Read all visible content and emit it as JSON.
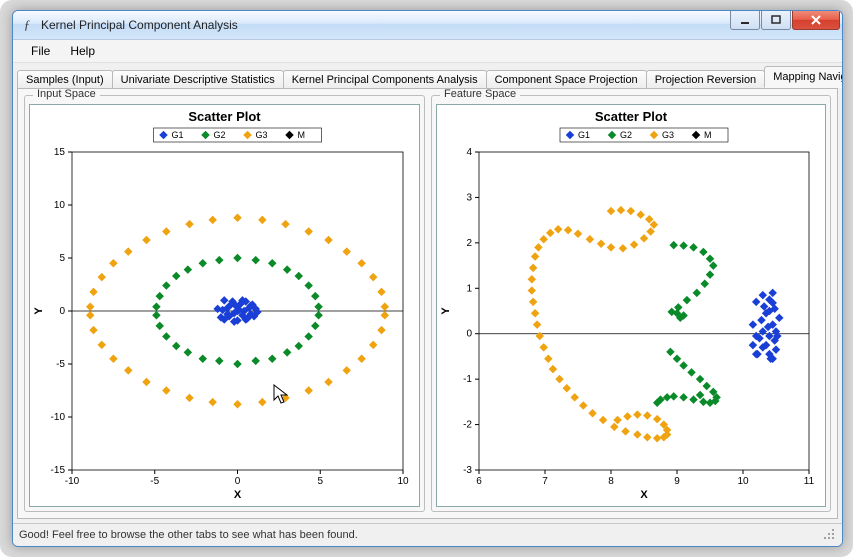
{
  "window": {
    "title": "Kernel Principal Component Analysis"
  },
  "menu": {
    "file": "File",
    "help": "Help"
  },
  "tabs": {
    "items": [
      {
        "label": "Samples (Input)"
      },
      {
        "label": "Univariate Descriptive Statistics"
      },
      {
        "label": "Kernel Principal Components Analysis"
      },
      {
        "label": "Component Space Projection"
      },
      {
        "label": "Projection Reversion"
      },
      {
        "label": "Mapping Navigation"
      }
    ],
    "active_index": 5
  },
  "panels": {
    "left_title": "Input Space",
    "right_title": "Feature Space"
  },
  "status": {
    "text": "Good! Feel free to browse the other tabs to see what has been found."
  },
  "chart_data": [
    {
      "type": "scatter",
      "title": "Scatter Plot",
      "xlabel": "X",
      "ylabel": "Y",
      "xlim": [
        -10,
        10
      ],
      "ylim": [
        -15,
        15
      ],
      "xticks": [
        -10,
        -5,
        0,
        5,
        10
      ],
      "yticks": [
        -15,
        -10,
        -5,
        0,
        5,
        10,
        15
      ],
      "legend": [
        "G1",
        "G2",
        "G3",
        "M"
      ],
      "colors": {
        "G1": "#1a3fd6",
        "G2": "#0a8a28",
        "G3": "#f0a310",
        "M": "#000000"
      },
      "series": [
        {
          "name": "G1",
          "points": [
            [
              -1.2,
              0.2
            ],
            [
              -1.0,
              -0.6
            ],
            [
              -0.8,
              1.0
            ],
            [
              -0.8,
              -0.8
            ],
            [
              -0.6,
              0.3
            ],
            [
              -0.5,
              -0.5
            ],
            [
              -0.3,
              0.9
            ],
            [
              -0.2,
              -0.2
            ],
            [
              -0.1,
              0.5
            ],
            [
              0.0,
              -0.9
            ],
            [
              0.1,
              0.1
            ],
            [
              0.2,
              0.7
            ],
            [
              0.3,
              -0.4
            ],
            [
              0.4,
              0.0
            ],
            [
              0.5,
              0.9
            ],
            [
              0.6,
              -0.7
            ],
            [
              0.7,
              0.3
            ],
            [
              0.8,
              -0.3
            ],
            [
              0.9,
              0.6
            ],
            [
              1.0,
              -0.5
            ],
            [
              1.1,
              0.2
            ],
            [
              1.2,
              -0.1
            ],
            [
              0.0,
              0.0
            ],
            [
              -0.4,
              0.6
            ],
            [
              0.5,
              -0.8
            ],
            [
              -0.9,
              0.1
            ],
            [
              0.3,
              1.0
            ],
            [
              -0.2,
              -1.0
            ],
            [
              0.8,
              0.5
            ],
            [
              -0.6,
              -0.3
            ]
          ]
        },
        {
          "name": "G2",
          "points": [
            [
              4.9,
              0.4
            ],
            [
              4.7,
              1.4
            ],
            [
              4.3,
              2.4
            ],
            [
              3.7,
              3.3
            ],
            [
              3.0,
              3.9
            ],
            [
              2.1,
              4.5
            ],
            [
              1.1,
              4.8
            ],
            [
              0.0,
              5.0
            ],
            [
              -1.1,
              4.8
            ],
            [
              -2.1,
              4.5
            ],
            [
              -3.0,
              3.9
            ],
            [
              -3.7,
              3.3
            ],
            [
              -4.3,
              2.4
            ],
            [
              -4.7,
              1.4
            ],
            [
              -4.9,
              0.4
            ],
            [
              -4.9,
              -0.4
            ],
            [
              -4.7,
              -1.4
            ],
            [
              -4.3,
              -2.4
            ],
            [
              -3.7,
              -3.3
            ],
            [
              -3.0,
              -3.9
            ],
            [
              -2.1,
              -4.5
            ],
            [
              -1.1,
              -4.7
            ],
            [
              0.0,
              -5.0
            ],
            [
              1.1,
              -4.7
            ],
            [
              2.1,
              -4.5
            ],
            [
              3.0,
              -3.9
            ],
            [
              3.7,
              -3.3
            ],
            [
              4.3,
              -2.4
            ],
            [
              4.7,
              -1.4
            ],
            [
              4.9,
              -0.4
            ]
          ]
        },
        {
          "name": "G3",
          "points": [
            [
              8.9,
              0.4
            ],
            [
              8.7,
              1.8
            ],
            [
              8.2,
              3.2
            ],
            [
              7.5,
              4.5
            ],
            [
              6.6,
              5.6
            ],
            [
              5.5,
              6.7
            ],
            [
              4.3,
              7.5
            ],
            [
              2.9,
              8.2
            ],
            [
              1.5,
              8.6
            ],
            [
              0.0,
              8.8
            ],
            [
              -1.5,
              8.6
            ],
            [
              -2.9,
              8.2
            ],
            [
              -4.3,
              7.5
            ],
            [
              -5.5,
              6.7
            ],
            [
              -6.6,
              5.6
            ],
            [
              -7.5,
              4.5
            ],
            [
              -8.2,
              3.2
            ],
            [
              -8.7,
              1.8
            ],
            [
              -8.9,
              0.4
            ],
            [
              -8.9,
              -0.4
            ],
            [
              -8.7,
              -1.8
            ],
            [
              -8.2,
              -3.2
            ],
            [
              -7.5,
              -4.5
            ],
            [
              -6.6,
              -5.6
            ],
            [
              -5.5,
              -6.7
            ],
            [
              -4.3,
              -7.5
            ],
            [
              -2.9,
              -8.2
            ],
            [
              -1.5,
              -8.6
            ],
            [
              0.0,
              -8.8
            ],
            [
              1.5,
              -8.6
            ],
            [
              2.9,
              -8.2
            ],
            [
              4.3,
              -7.5
            ],
            [
              5.5,
              -6.7
            ],
            [
              6.6,
              -5.6
            ],
            [
              7.5,
              -4.5
            ],
            [
              8.2,
              -3.2
            ],
            [
              8.7,
              -1.8
            ],
            [
              8.9,
              -0.4
            ]
          ]
        }
      ]
    },
    {
      "type": "scatter",
      "title": "Scatter Plot",
      "xlabel": "X",
      "ylabel": "Y",
      "xlim": [
        6,
        11
      ],
      "ylim": [
        -3,
        4
      ],
      "xticks": [
        6,
        7,
        8,
        9,
        10,
        11
      ],
      "yticks": [
        -3,
        -2,
        -1,
        0,
        1,
        2,
        3,
        4
      ],
      "legend": [
        "G1",
        "G2",
        "G3",
        "M"
      ],
      "colors": {
        "G1": "#1a3fd6",
        "G2": "#0a8a28",
        "G3": "#f0a310",
        "M": "#000000"
      },
      "series": [
        {
          "name": "G1",
          "points": [
            [
              10.45,
              0.9
            ],
            [
              10.45,
              0.68
            ],
            [
              10.4,
              0.5
            ],
            [
              10.55,
              0.35
            ],
            [
              10.45,
              0.2
            ],
            [
              10.5,
              0.05
            ],
            [
              10.4,
              -0.05
            ],
            [
              10.48,
              -0.15
            ],
            [
              10.35,
              -0.25
            ],
            [
              10.5,
              -0.35
            ],
            [
              10.4,
              -0.45
            ],
            [
              10.45,
              -0.55
            ],
            [
              10.3,
              0.85
            ],
            [
              10.32,
              0.6
            ],
            [
              10.28,
              0.3
            ],
            [
              10.3,
              0.05
            ],
            [
              10.25,
              -0.1
            ],
            [
              10.3,
              -0.3
            ],
            [
              10.22,
              -0.45
            ],
            [
              10.35,
              0.45
            ],
            [
              10.2,
              0.7
            ],
            [
              10.15,
              0.2
            ],
            [
              10.2,
              -0.05
            ],
            [
              10.15,
              -0.25
            ],
            [
              10.2,
              -0.45
            ],
            [
              10.4,
              0.75
            ],
            [
              10.48,
              0.55
            ],
            [
              10.38,
              0.15
            ],
            [
              10.52,
              -0.05
            ],
            [
              10.42,
              -0.55
            ]
          ]
        },
        {
          "name": "G2",
          "points": [
            [
              8.95,
              1.95
            ],
            [
              9.1,
              1.94
            ],
            [
              9.25,
              1.9
            ],
            [
              9.4,
              1.8
            ],
            [
              9.5,
              1.65
            ],
            [
              9.55,
              1.5
            ],
            [
              9.5,
              1.3
            ],
            [
              9.42,
              1.1
            ],
            [
              9.3,
              0.9
            ],
            [
              9.15,
              0.74
            ],
            [
              9.02,
              0.58
            ],
            [
              8.92,
              0.48
            ],
            [
              9.0,
              0.45
            ],
            [
              9.1,
              0.4
            ],
            [
              9.05,
              0.35
            ],
            [
              8.9,
              -0.4
            ],
            [
              9.0,
              -0.55
            ],
            [
              9.1,
              -0.7
            ],
            [
              9.22,
              -0.85
            ],
            [
              9.35,
              -1.0
            ],
            [
              9.45,
              -1.15
            ],
            [
              9.55,
              -1.28
            ],
            [
              9.6,
              -1.4
            ],
            [
              9.58,
              -1.48
            ],
            [
              9.5,
              -1.52
            ],
            [
              9.4,
              -1.5
            ],
            [
              9.25,
              -1.45
            ],
            [
              9.1,
              -1.4
            ],
            [
              8.95,
              -1.38
            ],
            [
              8.85,
              -1.4
            ],
            [
              8.75,
              -1.45
            ],
            [
              8.7,
              -1.52
            ],
            [
              9.35,
              -1.35
            ]
          ]
        },
        {
          "name": "G3",
          "points": [
            [
              8.0,
              2.7
            ],
            [
              8.15,
              2.72
            ],
            [
              8.3,
              2.7
            ],
            [
              8.45,
              2.62
            ],
            [
              8.58,
              2.52
            ],
            [
              8.65,
              2.4
            ],
            [
              8.6,
              2.25
            ],
            [
              8.5,
              2.1
            ],
            [
              8.35,
              1.96
            ],
            [
              8.18,
              1.88
            ],
            [
              8.0,
              1.9
            ],
            [
              7.85,
              1.98
            ],
            [
              7.68,
              2.08
            ],
            [
              7.5,
              2.2
            ],
            [
              7.35,
              2.28
            ],
            [
              7.2,
              2.3
            ],
            [
              7.08,
              2.22
            ],
            [
              6.98,
              2.08
            ],
            [
              6.9,
              1.9
            ],
            [
              6.85,
              1.7
            ],
            [
              6.82,
              1.45
            ],
            [
              6.8,
              1.2
            ],
            [
              6.8,
              0.95
            ],
            [
              6.82,
              0.7
            ],
            [
              6.85,
              0.45
            ],
            [
              6.88,
              0.2
            ],
            [
              6.92,
              -0.05
            ],
            [
              6.98,
              -0.3
            ],
            [
              7.05,
              -0.55
            ],
            [
              7.12,
              -0.78
            ],
            [
              7.22,
              -1.0
            ],
            [
              7.33,
              -1.2
            ],
            [
              7.45,
              -1.4
            ],
            [
              7.58,
              -1.58
            ],
            [
              7.72,
              -1.75
            ],
            [
              7.88,
              -1.9
            ],
            [
              8.05,
              -2.05
            ],
            [
              8.22,
              -2.15
            ],
            [
              8.4,
              -2.22
            ],
            [
              8.55,
              -2.28
            ],
            [
              8.7,
              -2.3
            ],
            [
              8.8,
              -2.28
            ],
            [
              8.85,
              -2.22
            ],
            [
              8.85,
              -2.12
            ],
            [
              8.8,
              -2.0
            ],
            [
              8.7,
              -1.88
            ],
            [
              8.55,
              -1.8
            ],
            [
              8.4,
              -1.78
            ],
            [
              8.25,
              -1.82
            ],
            [
              8.1,
              -1.9
            ]
          ]
        }
      ]
    }
  ]
}
